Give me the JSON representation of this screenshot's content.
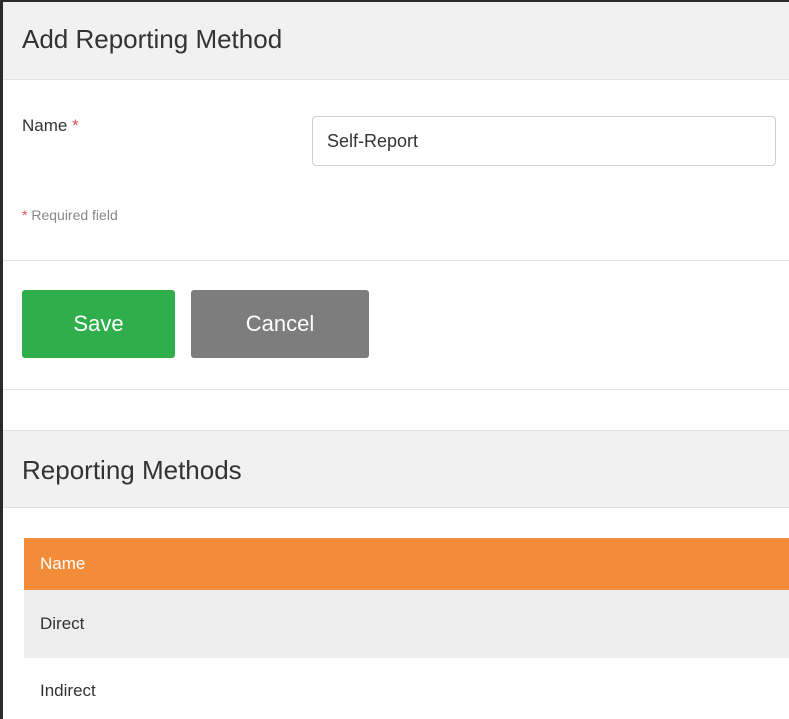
{
  "add_form": {
    "title": "Add Reporting Method",
    "name_label": "Name",
    "required_star": "*",
    "name_value": "Self-Report",
    "required_note": "Required field",
    "save_label": "Save",
    "cancel_label": "Cancel"
  },
  "list": {
    "title": "Reporting Methods",
    "column_header": "Name",
    "rows": [
      "Direct",
      "Indirect"
    ]
  },
  "colors": {
    "header_bg": "#f1f1f1",
    "save_button": "#2fae4c",
    "cancel_button": "#7d7d7d",
    "table_header": "#f28c38",
    "required_star": "#d9534f"
  }
}
